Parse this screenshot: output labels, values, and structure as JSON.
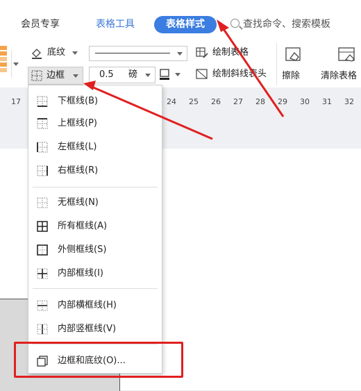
{
  "tabs": {
    "member": "会员专享",
    "table_tools": "表格工具",
    "table_style": "表格样式"
  },
  "search": {
    "placeholder": "查找命令、搜索模板"
  },
  "ribbon": {
    "shading_label": "底纹",
    "border_label": "边框",
    "line_width_value": "0.5",
    "line_width_unit": "磅",
    "draw_table": "绘制表格",
    "draw_diagonal_header": "绘制斜线表头",
    "erase": "擦除",
    "clear_table": "清除表格"
  },
  "ruler": {
    "ticks": [
      "17",
      "24",
      "25",
      "26",
      "27",
      "28",
      "29",
      "30",
      "31",
      "32"
    ]
  },
  "menu": {
    "items": [
      {
        "label": "下框线(B)",
        "icon": "border-bottom-icon"
      },
      {
        "label": "上框线(P)",
        "icon": "border-top-icon"
      },
      {
        "label": "左框线(L)",
        "icon": "border-left-icon"
      },
      {
        "label": "右框线(R)",
        "icon": "border-right-icon"
      },
      {
        "label": "无框线(N)",
        "icon": "border-none-icon"
      },
      {
        "label": "所有框线(A)",
        "icon": "border-all-icon"
      },
      {
        "label": "外侧框线(S)",
        "icon": "border-outside-icon"
      },
      {
        "label": "内部框线(I)",
        "icon": "border-inside-icon"
      },
      {
        "label": "内部横框线(H)",
        "icon": "border-inside-horizontal-icon"
      },
      {
        "label": "内部竖框线(V)",
        "icon": "border-inside-vertical-icon"
      },
      {
        "label": "边框和底纹(O)...",
        "icon": "borders-and-shading-icon"
      }
    ]
  },
  "colors": {
    "accent": "#3b7de0",
    "highlight": "#e02020"
  }
}
